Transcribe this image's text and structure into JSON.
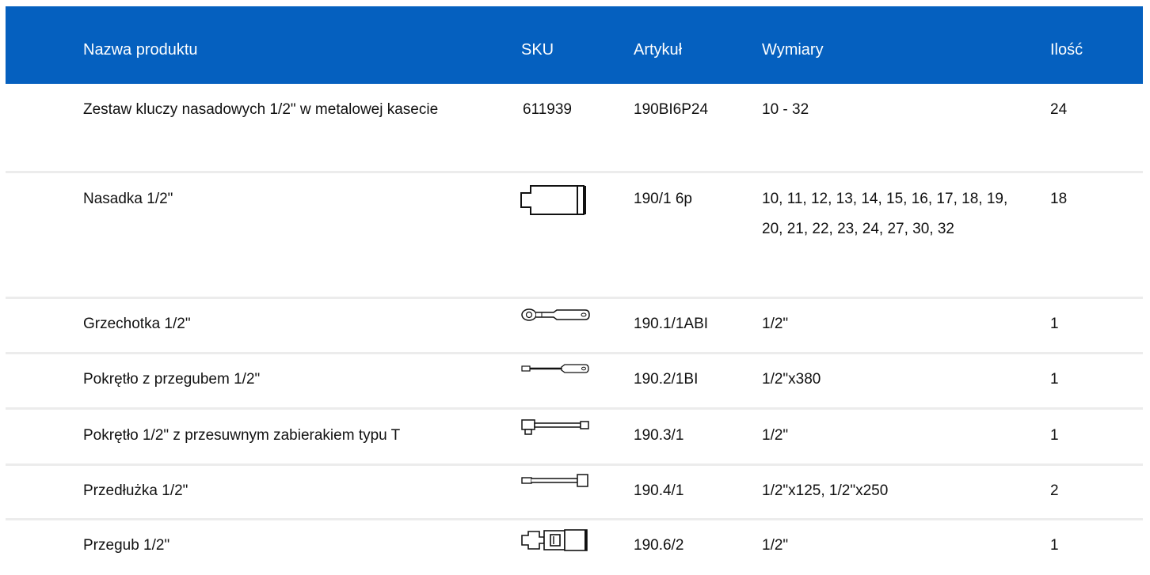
{
  "table": {
    "headers": {
      "name": "Nazwa produktu",
      "sku": "SKU",
      "article": "Artykuł",
      "dimensions": "Wymiary",
      "qty": "Ilość"
    },
    "rows": [
      {
        "name": "Zestaw kluczy nasadowych 1/2\" w metalowej kasecie",
        "sku": "611939",
        "sku_icon": "",
        "article": "190BI6P24",
        "dimensions": "10 - 32",
        "qty": "24"
      },
      {
        "name": "Nasadka 1/2\"",
        "sku": "",
        "sku_icon": "socket-icon",
        "article": "190/1 6p",
        "dimensions": "10, 11, 12, 13, 14, 15, 16, 17, 18, 19, 20, 21, 22, 23, 24, 27, 30, 32",
        "qty": "18"
      },
      {
        "name": "Grzechotka 1/2\"",
        "sku": "",
        "sku_icon": "ratchet-icon",
        "article": "190.1/1ABI",
        "dimensions": "1/2\"",
        "qty": "1"
      },
      {
        "name": "Pokrętło z przegubem 1/2\"",
        "sku": "",
        "sku_icon": "breaker-bar-icon",
        "article": "190.2/1BI",
        "dimensions": "1/2\"x380",
        "qty": "1"
      },
      {
        "name": "Pokrętło 1/2\" z przesuwnym zabierakiem typu T",
        "sku": "",
        "sku_icon": "t-handle-icon",
        "article": "190.3/1",
        "dimensions": "1/2\"",
        "qty": "1"
      },
      {
        "name": "Przedłużka 1/2\"",
        "sku": "",
        "sku_icon": "extension-bar-icon",
        "article": "190.4/1",
        "dimensions": "1/2\"x125, 1/2\"x250",
        "qty": "2"
      },
      {
        "name": "Przegub 1/2\"",
        "sku": "",
        "sku_icon": "universal-joint-icon",
        "article": "190.6/2",
        "dimensions": "1/2\"",
        "qty": "1"
      }
    ]
  },
  "colors": {
    "header_bg": "#0560bf",
    "header_text": "#ffffff",
    "row_separator": "#ececec"
  }
}
